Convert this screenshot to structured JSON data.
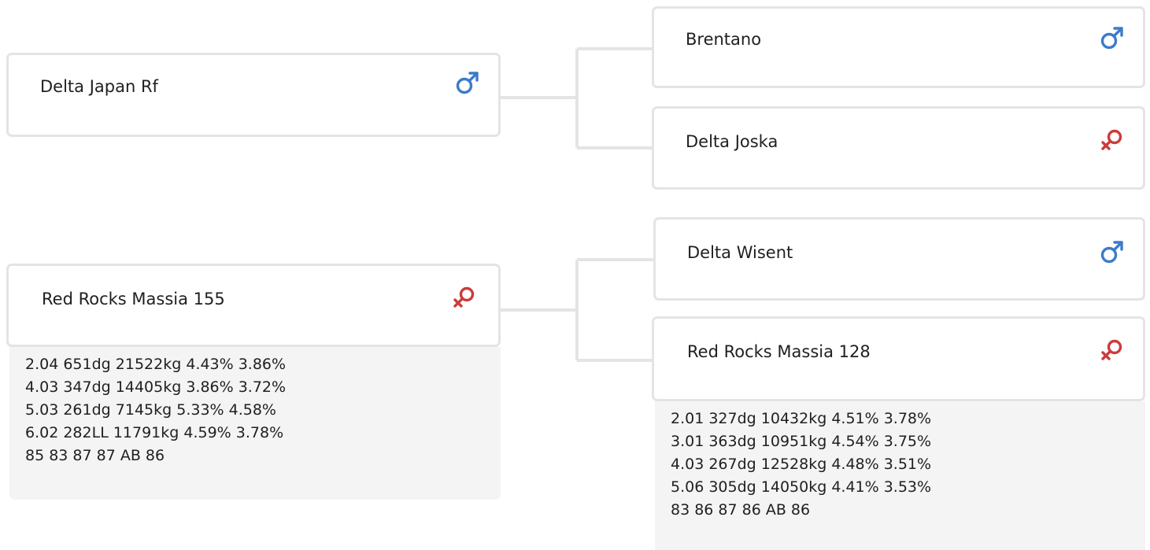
{
  "colors": {
    "male": "#3b7cc9",
    "female": "#cc3b3b",
    "card_border": "#e4e4e4",
    "connector": "#e4e4e4",
    "stats_background": "#f4f4f4"
  },
  "animals": {
    "sire": {
      "name": "Delta Japan Rf",
      "sex": "male",
      "icon": "male-icon"
    },
    "sire_sire": {
      "name": "Brentano",
      "sex": "male",
      "icon": "male-icon"
    },
    "sire_dam": {
      "name": "Delta Joska",
      "sex": "female",
      "icon": "female-icon"
    },
    "dam": {
      "name": "Red Rocks Massia 155",
      "sex": "female",
      "icon": "female-icon",
      "stats": [
        "2.04 651dg 21522kg 4.43% 3.86%",
        "4.03 347dg 14405kg 3.86% 3.72%",
        "5.03 261dg 7145kg 5.33% 4.58%",
        "6.02 282LL 11791kg 4.59% 3.78%",
        "85 83 87 87 AB 86"
      ]
    },
    "dam_sire": {
      "name": "Delta Wisent",
      "sex": "male",
      "icon": "male-icon"
    },
    "dam_dam": {
      "name": "Red Rocks Massia 128",
      "sex": "female",
      "icon": "female-icon",
      "stats": [
        "2.01 327dg 10432kg 4.51% 3.78%",
        "3.01 363dg 10951kg 4.54% 3.75%",
        "4.03 267dg 12528kg 4.48% 3.51%",
        "5.06 305dg 14050kg 4.41% 3.53%",
        "83 86 87 86 AB 86"
      ]
    }
  }
}
